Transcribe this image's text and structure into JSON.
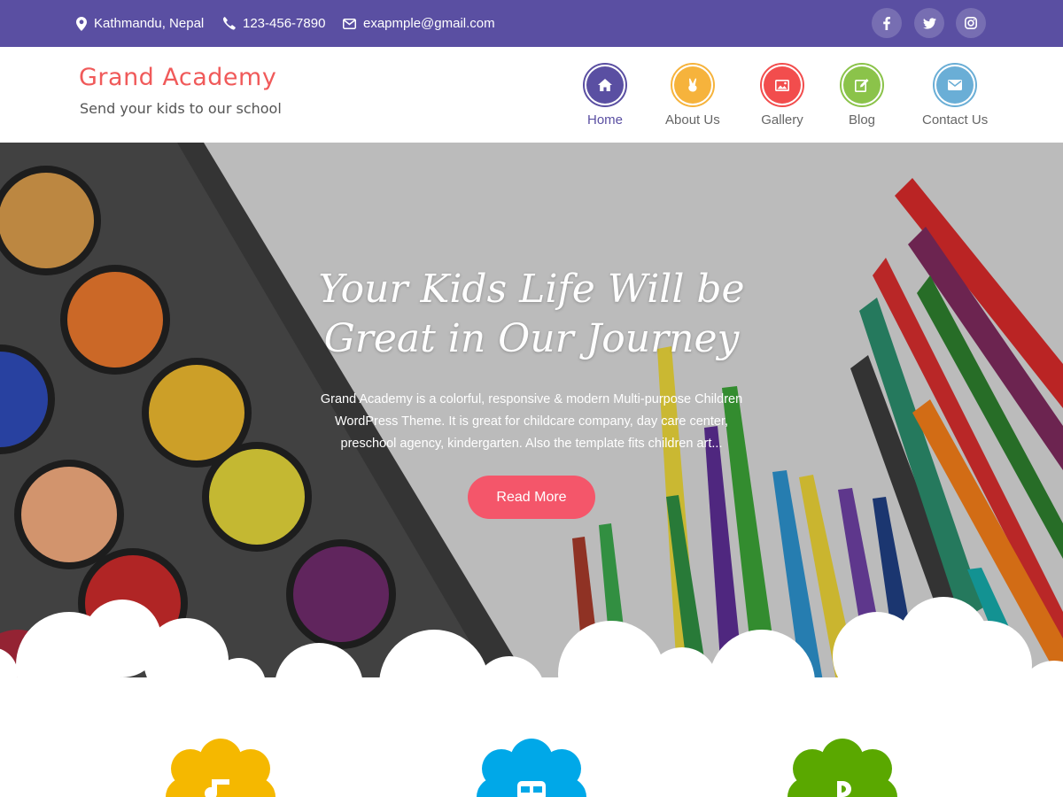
{
  "topbar": {
    "location": "Kathmandu, Nepal",
    "phone": "123-456-7890",
    "email": "exapmple@gmail.com",
    "social": [
      "facebook-icon",
      "twitter-icon",
      "instagram-icon"
    ],
    "bg_color": "#5a4fa2"
  },
  "header": {
    "title": "Grand Academy",
    "tagline": "Send your kids to our school",
    "title_color": "#f05a5a"
  },
  "nav": {
    "items": [
      {
        "label": "Home",
        "icon": "home-icon",
        "color": "#5a4fa2",
        "active": true
      },
      {
        "label": "About Us",
        "icon": "hand-icon",
        "color": "#f6b33c",
        "active": false
      },
      {
        "label": "Gallery",
        "icon": "image-icon",
        "color": "#f24d4d",
        "active": false
      },
      {
        "label": "Blog",
        "icon": "edit-icon",
        "color": "#8bc34a",
        "active": false
      },
      {
        "label": "Contact Us",
        "icon": "envelope-icon",
        "color": "#6aaed6",
        "active": false
      }
    ]
  },
  "hero": {
    "title_line1": "Your Kids Life Will be",
    "title_line2": "Great in Our Journey",
    "text": "Grand Academy is a colorful, responsive & modern Multi-purpose Children WordPress Theme. It is great for childcare company, day care center, preschool agency, kindergarten. Also the template fits children art...",
    "button": "Read More",
    "button_color": "#f4566a"
  },
  "features": [
    {
      "icon": "music-icon",
      "color": "#f5b800"
    },
    {
      "icon": "bus-icon",
      "color": "#00a8e8"
    },
    {
      "icon": "letter-icon",
      "color": "#5aa800"
    }
  ]
}
